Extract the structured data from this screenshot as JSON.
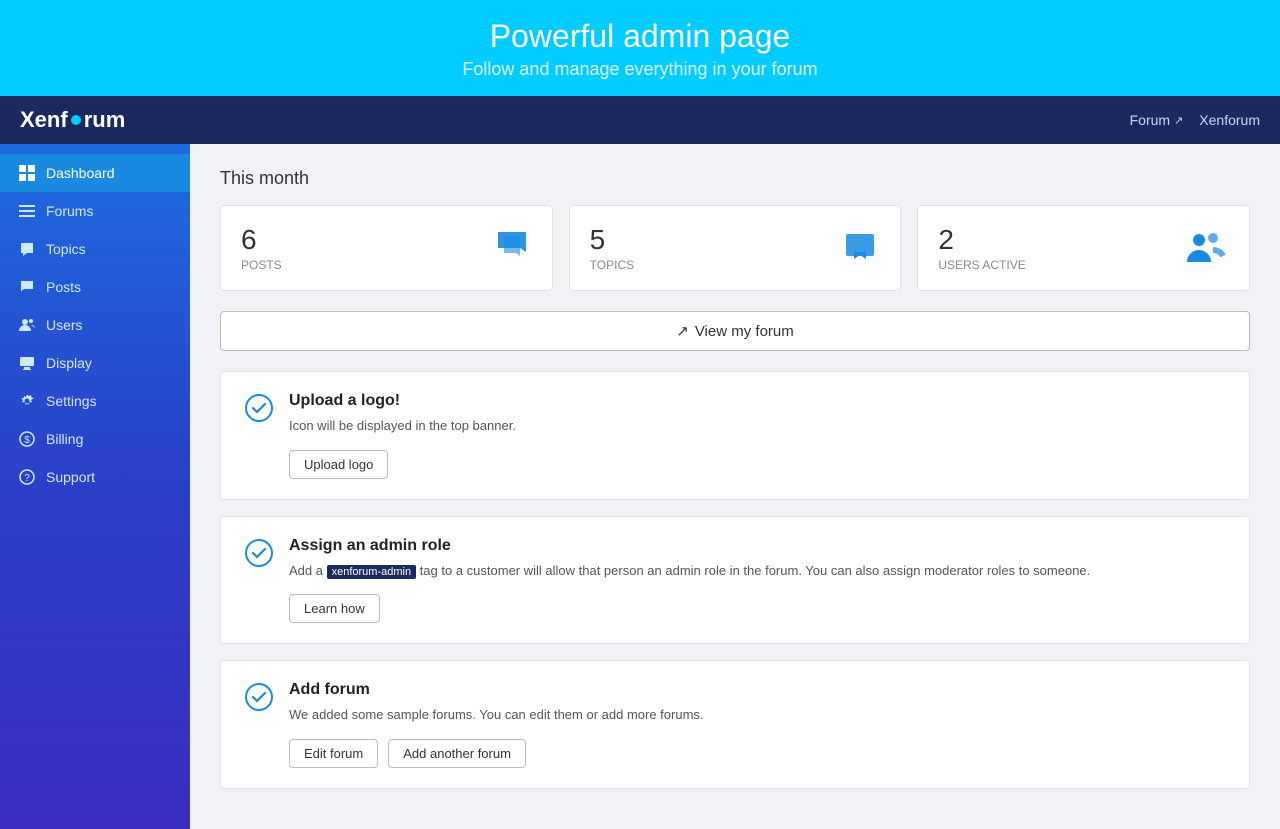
{
  "hero": {
    "title": "Powerful admin page",
    "subtitle": "Follow and manage everything in your forum"
  },
  "topnav": {
    "logo_text_before": "Xenf",
    "logo_text_after": "rum",
    "forum_link": "Forum",
    "username": "Xenforum"
  },
  "sidebar": {
    "items": [
      {
        "label": "Dashboard",
        "icon": "dashboard-icon",
        "active": true
      },
      {
        "label": "Forums",
        "icon": "forums-icon",
        "active": false
      },
      {
        "label": "Topics",
        "icon": "topics-icon",
        "active": false
      },
      {
        "label": "Posts",
        "icon": "posts-icon",
        "active": false
      },
      {
        "label": "Users",
        "icon": "users-icon",
        "active": false
      },
      {
        "label": "Display",
        "icon": "display-icon",
        "active": false
      },
      {
        "label": "Settings",
        "icon": "settings-icon",
        "active": false
      },
      {
        "label": "Billing",
        "icon": "billing-icon",
        "active": false
      },
      {
        "label": "Support",
        "icon": "support-icon",
        "active": false
      }
    ]
  },
  "main": {
    "section_title": "This month",
    "stats": [
      {
        "number": "6",
        "label": "POSTS"
      },
      {
        "number": "5",
        "label": "TOPICS"
      },
      {
        "number": "2",
        "label": "USERS ACTIVE"
      }
    ],
    "view_forum_btn": "View my forum",
    "tasks": [
      {
        "title": "Upload a logo!",
        "desc": "Icon will be displayed in the top banner.",
        "buttons": [
          "Upload logo"
        ]
      },
      {
        "title": "Assign an admin role",
        "desc_before": "Add a ",
        "desc_tag": "xenforum-admin",
        "desc_after": " tag to a customer will allow that person an admin role in the forum. You can also assign moderator roles to someone.",
        "buttons": [
          "Learn how"
        ]
      },
      {
        "title": "Add forum",
        "desc": "We added some sample forums. You can edit them or add more forums.",
        "buttons": [
          "Edit forum",
          "Add another forum"
        ]
      }
    ]
  }
}
